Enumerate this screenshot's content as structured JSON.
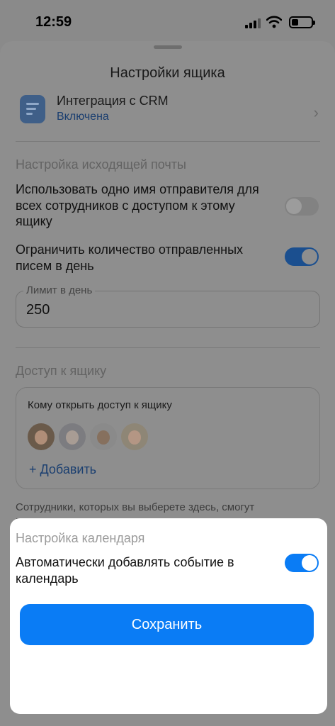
{
  "status_bar": {
    "time": "12:59",
    "icons": [
      "signal-icon",
      "wifi-icon",
      "battery-icon"
    ]
  },
  "sheet": {
    "title": "Настройки ящика"
  },
  "crm": {
    "title": "Интеграция с CRM",
    "status": "Включена",
    "icon": "crm-icon",
    "chevron": "›"
  },
  "outgoing": {
    "header": "Настройка исходящей почты",
    "same_sender": {
      "label": "Использовать одно имя отправителя для всех сотрудников с доступом к этому ящику",
      "enabled": false
    },
    "limit_emails": {
      "label": "Ограничить количество отправленных писем в день",
      "enabled": true
    },
    "limit_field": {
      "label": "Лимит в день",
      "value": "250"
    }
  },
  "access": {
    "header": "Доступ к ящику",
    "box_title": "Кому открыть доступ к ящику",
    "avatars": [
      "user-avatar-1",
      "user-avatar-2",
      "user-avatar-3",
      "user-avatar-4"
    ],
    "add_label": "+ Добавить",
    "help": "Сотрудники, которых вы выберете здесь, смогут просматривать письма из этого ящика и отвечать на них"
  },
  "calendar": {
    "header": "Настройка календаря",
    "auto_add": {
      "label": "Автоматически добавлять событие в календарь",
      "enabled": true
    }
  },
  "save_button": "Сохранить",
  "colors": {
    "accent": "#0A7CF5",
    "link": "#1B3F70",
    "dim_overlay": "#8E8E8E"
  }
}
